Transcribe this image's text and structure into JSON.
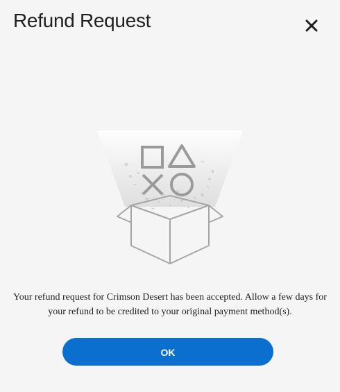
{
  "dialog": {
    "title": "Refund Request",
    "close_icon": "close-icon",
    "message": "Your refund request for Crimson Desert has been accepted. Allow a few days for your refund to be credited to your original payment method(s).",
    "ok_label": "OK"
  },
  "illustration": {
    "icons": [
      "square-symbol-icon",
      "triangle-symbol-icon",
      "cross-symbol-icon",
      "circle-symbol-icon",
      "open-box-icon"
    ]
  },
  "colors": {
    "background": "#f5f5f5",
    "button": "#0a6fcf",
    "button_text": "#ffffff",
    "text": "#1f1f1f",
    "illustration_stroke": "#9a9a9a"
  }
}
